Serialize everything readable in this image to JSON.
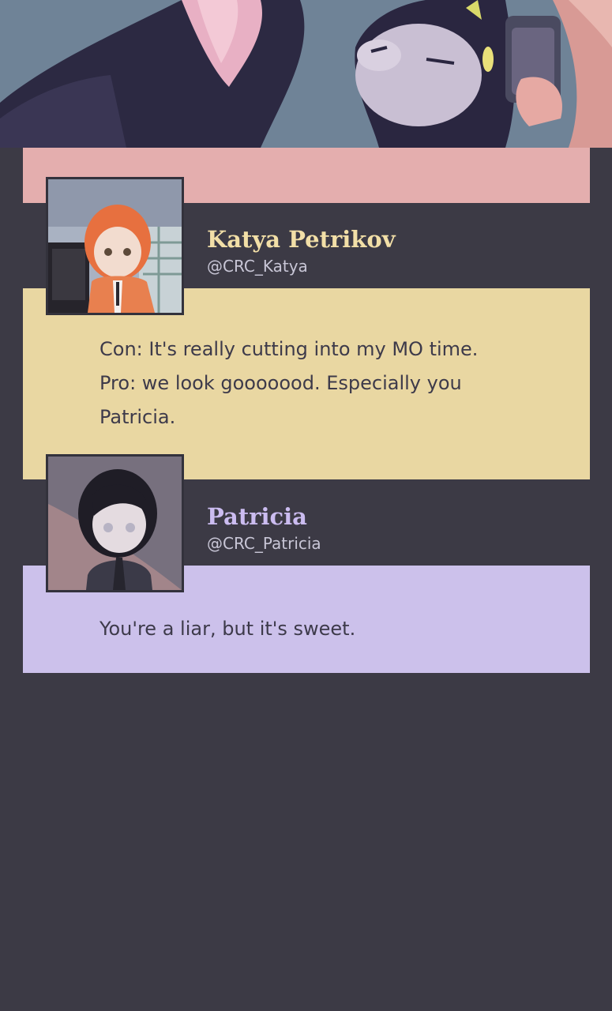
{
  "colors": {
    "background": "#3c3a45",
    "pink_bar": "#e4aeae",
    "katya_accent": "#e9d7a2",
    "katya_name": "#f2dfa7",
    "patricia_accent": "#ccc1eb",
    "patricia_name": "#cbbcf0",
    "body_text": "#3d3a4a",
    "handle_text": "#c8c6d6"
  },
  "banner": {
    "icon": "comic-banner-illustration"
  },
  "posts": [
    {
      "author": "Katya Petrikov",
      "handle": "@CRC_Katya",
      "avatar_icon": "katya-avatar-icon",
      "text": "Con: It's really cutting into my MO time.\nPro: we look gooooood. Especially you Patricia."
    },
    {
      "author": "Patricia",
      "handle": "@CRC_Patricia",
      "avatar_icon": "patricia-avatar-icon",
      "text": "You're a liar, but it's sweet."
    }
  ]
}
